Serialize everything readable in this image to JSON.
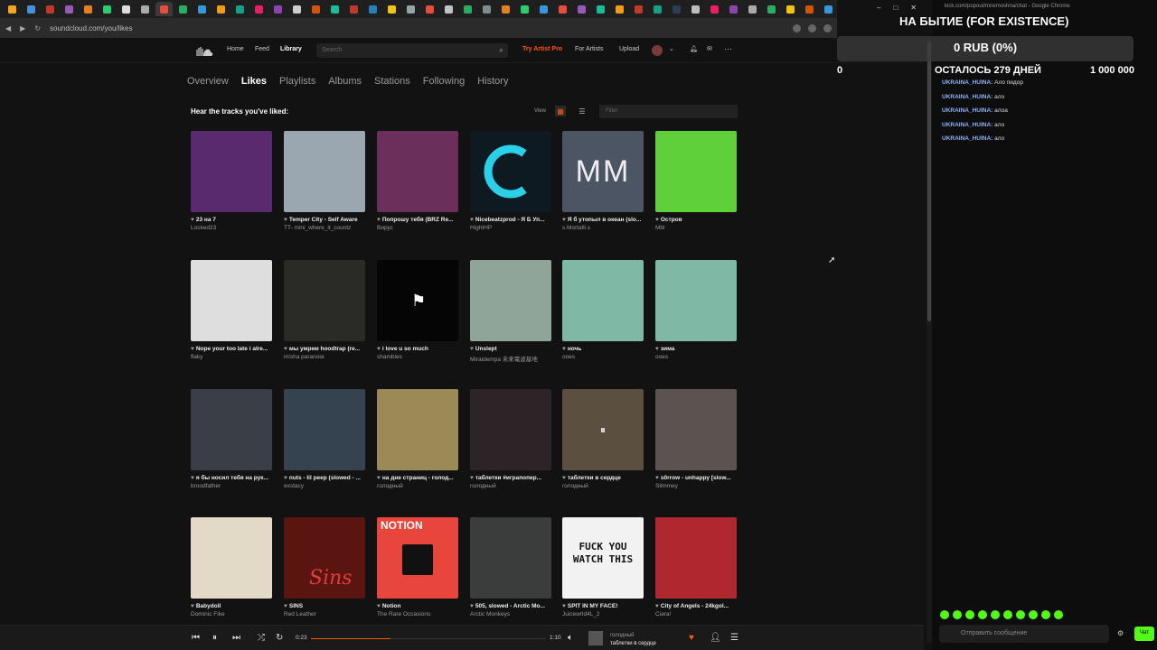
{
  "browser": {
    "url": "soundcloud.com/you/likes"
  },
  "header": {
    "home": "Home",
    "feed": "Feed",
    "library": "Library",
    "search_placeholder": "Search",
    "try_pro": "Try Artist Pro",
    "for_artists": "For Artists",
    "upload": "Upload"
  },
  "tabs": [
    "Overview",
    "Likes",
    "Playlists",
    "Albums",
    "Stations",
    "Following",
    "History"
  ],
  "content": {
    "heading": "Hear the tracks you've liked:",
    "view_label": "View",
    "filter_placeholder": "Filter"
  },
  "tracks": [
    {
      "title": "23 на 7",
      "artist": "Locked23",
      "color": "#5a2a6e"
    },
    {
      "title": "Temper City - Self Aware",
      "artist": "TT- mini_where_it_countz",
      "color": "#9aa7b0"
    },
    {
      "title": "Попрошу тебя (BRZ Re...",
      "artist": "Вирус",
      "color": "#6a2f5a"
    },
    {
      "title": "Nicebeatzprod - Я Б Уп...",
      "artist": "HightHP",
      "color": "#0d1a22"
    },
    {
      "title": "Я б утопыл в океан (slo...",
      "artist": "s.Mortalll.s",
      "color": "#4c5563"
    },
    {
      "title": "Остров",
      "artist": "Mbl",
      "color": "#5fcf3a"
    },
    {
      "title": "Nope your too late i alre...",
      "artist": "flaky",
      "color": "#dedede"
    },
    {
      "title": "мы умрем hoodtrap (re...",
      "artist": "misha paranoia",
      "color": "#2a2a26"
    },
    {
      "title": "i love u so much",
      "artist": "shambles",
      "color": "#050505"
    },
    {
      "title": "Unslept",
      "artist": "Miraidempa 未来電波基地",
      "color": "#8fa59a"
    },
    {
      "title": "ночь",
      "artist": "ooes",
      "color": "#7fb9a6"
    },
    {
      "title": "зима",
      "artist": "ooes",
      "color": "#7fb9a6"
    },
    {
      "title": "я бы носил тебя на рук...",
      "artist": "broodfather",
      "color": "#3a3e47"
    },
    {
      "title": "nuts - lil peep (slowed - ...",
      "artist": "exstacy",
      "color": "#34434f"
    },
    {
      "title": "на дне страниц - голод...",
      "artist": "голодный",
      "color": "#9b8a55"
    },
    {
      "title": "таблетки #играпопер...",
      "artist": "голодный",
      "color": "#2c2426"
    },
    {
      "title": "таблетки в сердце",
      "artist": "голодный",
      "color": "#5b5040"
    },
    {
      "title": "s0rrow - unhappy [slow...",
      "artist": "Slimmey",
      "color": "#5a5350"
    },
    {
      "title": "Babydoll",
      "artist": "Dominic Fike",
      "color": "#e2d9c6"
    },
    {
      "title": "SINS",
      "artist": "Red Leather",
      "color": "#5a1510"
    },
    {
      "title": "Notion",
      "artist": "The Rare Occasions",
      "color": "#e8463c"
    },
    {
      "title": "505, slowed - Arctic Mo...",
      "artist": "Arctic Monkeys",
      "color": "#3b3d3d"
    },
    {
      "title": "SPIT IN MY FACE!",
      "artist": "Juicewrld4L_2",
      "color": "#f2f2f2"
    },
    {
      "title": "City of Angels - 24kgol...",
      "artist": "Ciara!",
      "color": "#b0282f"
    }
  ],
  "mm_text": "MM",
  "notion_text": "NOTION",
  "sins_text": "Sins",
  "spit_text": "FUCK YOU WATCH THIS",
  "player": {
    "elapsed": "0:23",
    "duration": "1:10",
    "progress": 0.34,
    "artist": "голодный",
    "title": "таблетки в сердце"
  },
  "chat": {
    "window_title": "kick.com/popout/mnemoshna/chat - Google Chrome",
    "overlay_title": "НА БЫТИЕ (FOR EXISTENCE)",
    "goal": "0 RUB (0%)",
    "left_value": "0",
    "days_left": "ОСТАЛОСЬ 279 ДНЕЙ",
    "target": "1 000 000",
    "messages": [
      {
        "user": "UKRAINA_HUINA",
        "text": "Ало пидор"
      },
      {
        "user": "UKRAINA_HUINA",
        "text": "ало"
      },
      {
        "user": "UKRAINA_HUINA",
        "text": "алоа"
      },
      {
        "user": "UKRAINA_HUINA",
        "text": "ало"
      },
      {
        "user": "UKRAINA_HUINA",
        "text": "ало"
      }
    ],
    "input_placeholder": "Отправить сообщение",
    "send_label": "Чат"
  }
}
